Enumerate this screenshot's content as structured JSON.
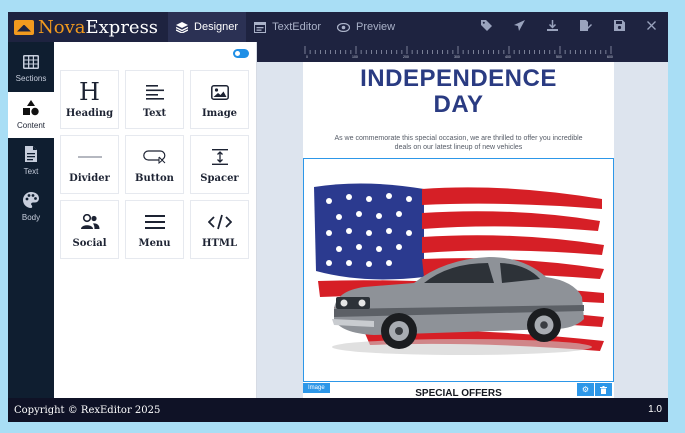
{
  "brand": {
    "name_part1": "Nova",
    "name_part2": "Express"
  },
  "tabs": [
    {
      "label": "Designer",
      "icon": "layers-icon",
      "active": true
    },
    {
      "label": "TextEditor",
      "icon": "code-window-icon",
      "active": false
    },
    {
      "label": "Preview",
      "icon": "eye-icon",
      "active": false
    }
  ],
  "toolbar_icons": [
    "tag-icon",
    "send-icon",
    "download-icon",
    "edit-icon",
    "save-icon",
    "close-icon"
  ],
  "sidebar": {
    "items": [
      {
        "label": "Sections",
        "icon": "grid-icon",
        "active": false
      },
      {
        "label": "Content",
        "icon": "shapes-icon",
        "active": true
      },
      {
        "label": "Text",
        "icon": "file-icon",
        "active": false
      },
      {
        "label": "Body",
        "icon": "palette-icon",
        "active": false
      }
    ]
  },
  "content_tiles": [
    {
      "label": "Heading",
      "icon": "heading-icon"
    },
    {
      "label": "Text",
      "icon": "text-lines-icon"
    },
    {
      "label": "Image",
      "icon": "image-icon"
    },
    {
      "label": "Divider",
      "icon": "divider-icon"
    },
    {
      "label": "Button",
      "icon": "button-icon"
    },
    {
      "label": "Spacer",
      "icon": "spacer-icon"
    },
    {
      "label": "Social",
      "icon": "users-icon"
    },
    {
      "label": "Menu",
      "icon": "menu-icon"
    },
    {
      "label": "HTML",
      "icon": "code-icon"
    }
  ],
  "ruler": {
    "labels": [
      "0",
      "100",
      "200",
      "300",
      "400",
      "500",
      "600"
    ]
  },
  "email": {
    "headline_line1": "INDEPENDENCE",
    "headline_line2": "DAY",
    "subtext": "As we commemorate this special occasion, we are thrilled to offer you incredible deals on our latest lineup of new vehicles",
    "image_tag": "Image",
    "special_offers": "SPECIAL OFFERS"
  },
  "footer": {
    "copyright": "Copyright © RexEditor 2025",
    "version": "1.0"
  },
  "colors": {
    "topbar": "#1e2340",
    "sidebar": "#0f1e30",
    "accent": "#2d97e8",
    "brand_orange": "#f29a1e",
    "headline": "#2a3b82",
    "page_bg": "#a9def5"
  }
}
